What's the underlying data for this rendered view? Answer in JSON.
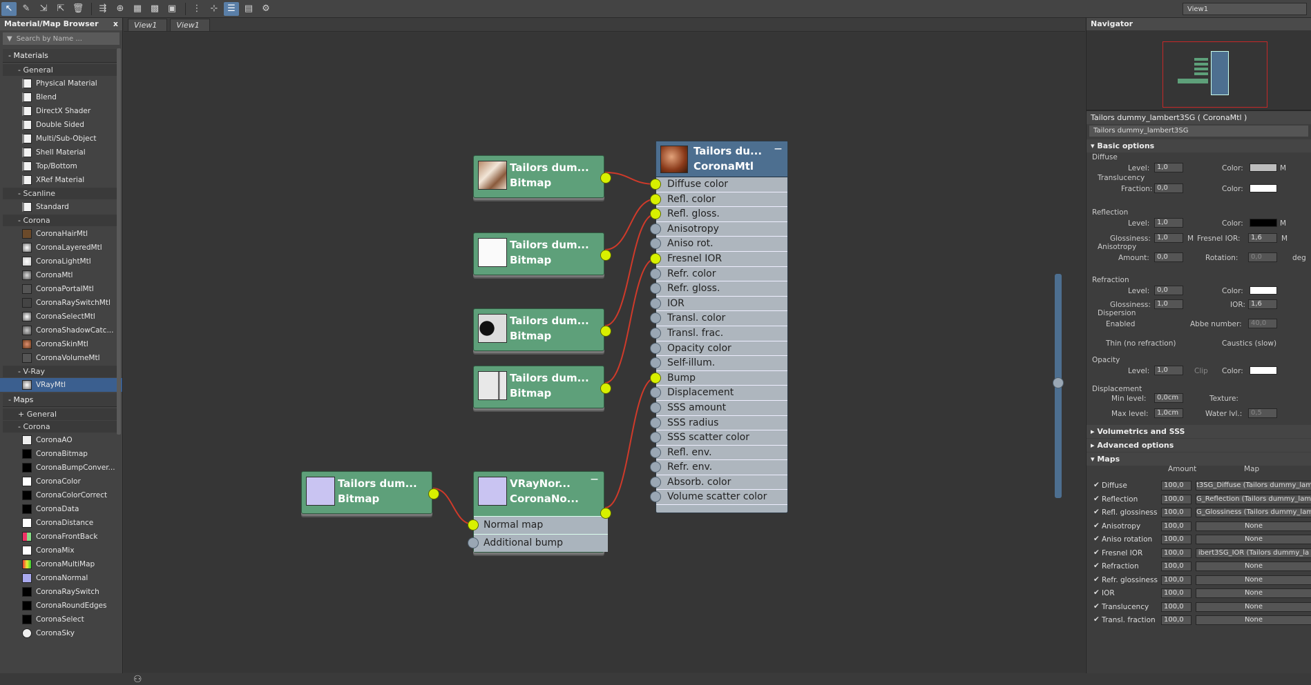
{
  "toolbar": {
    "view_select": "View1"
  },
  "browser": {
    "title": "Material/Map Browser",
    "close": "x",
    "search_placeholder": "Search by Name ...",
    "materials_group": "- Materials",
    "general_sub": "- General",
    "general_items": [
      "Physical Material",
      "Blend",
      "DirectX Shader",
      "Double Sided",
      "Multi/Sub-Object",
      "Shell Material",
      "Top/Bottom",
      "XRef Material"
    ],
    "scanline_sub": "- Scanline",
    "scanline_items": [
      "Standard"
    ],
    "corona_sub": "- Corona",
    "corona_items": [
      "CoronaHairMtl",
      "CoronaLayeredMtl",
      "CoronaLightMtl",
      "CoronaMtl",
      "CoronaPortalMtl",
      "CoronaRaySwitchMtl",
      "CoronaSelectMtl",
      "CoronaShadowCatc...",
      "CoronaSkinMtl",
      "CoronaVolumeMtl"
    ],
    "vray_sub": "- V-Ray",
    "vray_items": [
      "VRayMtl"
    ],
    "maps_group": "- Maps",
    "maps_general": "+ General",
    "maps_corona": "- Corona",
    "maps_corona_items": [
      "CoronaAO",
      "CoronaBitmap",
      "CoronaBumpConver...",
      "CoronaColor",
      "CoronaColorCorrect",
      "CoronaData",
      "CoronaDistance",
      "CoronaFrontBack",
      "CoronaMix",
      "CoronaMultiMap",
      "CoronaNormal",
      "CoronaRaySwitch",
      "CoronaRoundEdges",
      "CoronaSelect",
      "CoronaSky"
    ]
  },
  "graph": {
    "tabs": [
      "View1",
      "View1"
    ],
    "bitmap_title": "Tailors dum...",
    "bitmap_type": "Bitmap",
    "material_title": "Tailors du...",
    "material_type": "CoronaMtl",
    "minimize": "—",
    "normal_title": "VRayNor...",
    "normal_type": "CoronaNo...",
    "normal_slots": [
      "Normal map",
      "Additional bump"
    ],
    "material_slots": [
      "Diffuse color",
      "Refl. color",
      "Refl. gloss.",
      "Anisotropy",
      "Aniso rot.",
      "Fresnel IOR",
      "Refr. color",
      "Refr. gloss.",
      "IOR",
      "Transl. color",
      "Transl. frac.",
      "Opacity color",
      "Self-illum.",
      "Bump",
      "Displacement",
      "SSS amount",
      "SSS radius",
      "SSS scatter color",
      "Refl. env.",
      "Refr. env.",
      "Absorb. color",
      "Volume scatter color"
    ],
    "material_connected": [
      true,
      true,
      true,
      false,
      false,
      true,
      false,
      false,
      false,
      false,
      false,
      false,
      false,
      true,
      false,
      false,
      false,
      false,
      false,
      false,
      false,
      false
    ]
  },
  "right": {
    "navigator": "Navigator",
    "param_title": "Tailors dummy_lambert3SG  ( CoronaMtl )",
    "param_name": "Tailors dummy_lambert3SG",
    "basic_options": "Basic options",
    "diffuse": "Diffuse",
    "level": "Level:",
    "color": "Color:",
    "translucency": "Translucency",
    "fraction": "Fraction:",
    "reflection": "Reflection",
    "glossiness": "Glossiness:",
    "fresnel_ior": "Fresnel IOR:",
    "anisotropy": "Anisotropy",
    "amount": "Amount:",
    "rotation": "Rotation:",
    "deg": "deg",
    "refraction": "Refraction",
    "ior": "IOR:",
    "dispersion": "Dispersion",
    "enabled": "Enabled",
    "abbe": "Abbe number:",
    "thin": "Thin (no refraction)",
    "caustics": "Caustics (slow)",
    "opacity": "Opacity",
    "clip": "Clip",
    "displacement": "Displacement",
    "min_level": "Min level:",
    "max_level": "Max level:",
    "texture": "Texture:",
    "water": "Water lvl.:",
    "m": "M",
    "values": {
      "v10": "1,0",
      "v00": "0,0",
      "v16": "1,6",
      "v400": "40,0",
      "v0cm": "0,0cm",
      "v1cm": "1,0cm",
      "v05": "0,5"
    },
    "vol_sss": "Volumetrics and SSS",
    "advanced": "Advanced options",
    "maps": "Maps",
    "amount_h": "Amount",
    "map_h": "Map",
    "maps_rows": [
      {
        "name": "Diffuse",
        "amount": "100,0",
        "map": "t3SG_Diffuse (Tailors dummy_lam"
      },
      {
        "name": "Reflection",
        "amount": "100,0",
        "map": "G_Reflection (Tailors dummy_lam"
      },
      {
        "name": "Refl. glossiness",
        "amount": "100,0",
        "map": "G_Glossiness (Tailors dummy_lam"
      },
      {
        "name": "Anisotropy",
        "amount": "100,0",
        "map": "None"
      },
      {
        "name": "Aniso rotation",
        "amount": "100,0",
        "map": "None"
      },
      {
        "name": "Fresnel IOR",
        "amount": "100,0",
        "map": "ibert3SG_IOR (Tailors dummy_la"
      },
      {
        "name": "Refraction",
        "amount": "100,0",
        "map": "None"
      },
      {
        "name": "Refr. glossiness",
        "amount": "100,0",
        "map": "None"
      },
      {
        "name": "IOR",
        "amount": "100,0",
        "map": "None"
      },
      {
        "name": "Translucency",
        "amount": "100,0",
        "map": "None"
      },
      {
        "name": "Transl. fraction",
        "amount": "100,0",
        "map": "None"
      }
    ]
  },
  "colors": {
    "node_green": "#5ea07a",
    "material_blue": "#4d6f90",
    "port_active": "#d8f000",
    "wire": "#d03a2a"
  }
}
